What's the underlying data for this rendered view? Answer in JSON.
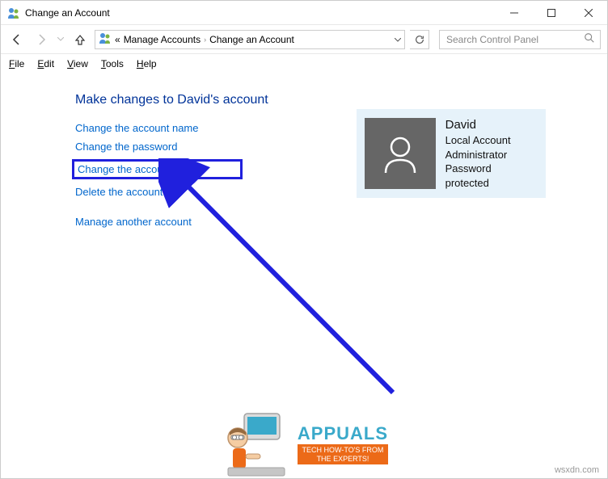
{
  "window": {
    "title": "Change an Account"
  },
  "breadcrumb": {
    "prefix": "«",
    "items": [
      "Manage Accounts",
      "Change an Account"
    ]
  },
  "search": {
    "placeholder": "Search Control Panel"
  },
  "menus": {
    "file": "File",
    "edit": "Edit",
    "view": "View",
    "tools": "Tools",
    "help": "Help"
  },
  "main": {
    "heading": "Make changes to David's account",
    "actions": {
      "changeName": "Change the account name",
      "changePassword": "Change the password",
      "changeType": "Change the account type",
      "delete": "Delete the account",
      "manageAnother": "Manage another account"
    }
  },
  "user": {
    "name": "David",
    "type": "Local Account",
    "role": "Administrator",
    "protection": "Password protected"
  },
  "branding": {
    "name": "APPUALS",
    "tagline1": "TECH HOW-TO'S FROM",
    "tagline2": "THE EXPERTS!"
  },
  "footer": {
    "site": "wsxdn.com"
  }
}
